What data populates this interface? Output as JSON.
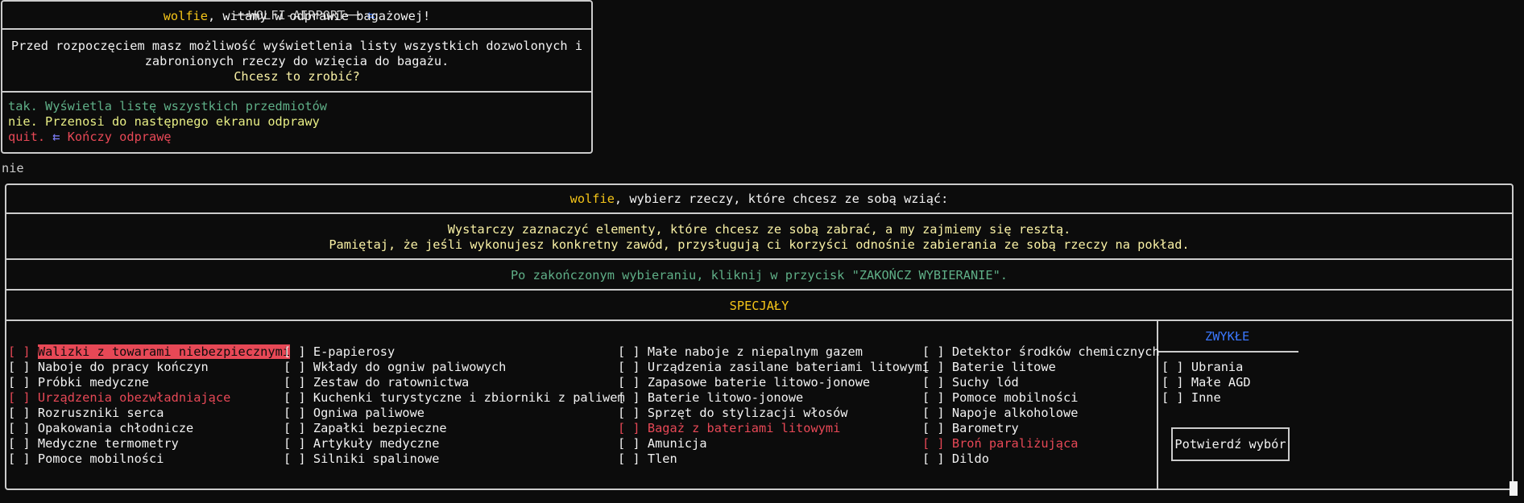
{
  "welcome_box": {
    "title": "WOLFI-AIRPORT",
    "greeting_user": "wolfie",
    "greeting_rest": ", witamy w odprawie bagażowej!",
    "info_line1": "Przed rozpoczęciem masz możliwość wyświetlenia listy wszystkich dozwolonych i",
    "info_line2": "zabronionych rzeczy do wzięcia do bagażu.",
    "question": "Chcesz to zrobić?",
    "options": [
      {
        "key": "tak.",
        "desc": " Wyświetla listę wszystkich przedmiotów"
      },
      {
        "key": "nie.",
        "desc": " Przenosi do następnego ekranu odprawy"
      },
      {
        "key": "quit.",
        "desc": " Kończy odprawę"
      }
    ]
  },
  "user_input": "nie",
  "selection": {
    "header_user": "wolfie",
    "header_rest": ", wybierz rzeczy, które chcesz ze sobą wziąć:",
    "instr_line1": "Wystarczy zaznaczyć elementy, które chcesz ze sobą zabrać, a my zajmiemy się resztą.",
    "instr_line2": "Pamiętaj, że jeśli wykonujesz konkretny zawód, przysługują ci korzyści odnośnie zabierania ze sobą rzeczy na pokład.",
    "finish_hint": "Po zakończonym wybieraniu, kliknij w przycisk \"ZAKOŃCZ WYBIERANIE\".",
    "specials_title": "SPECJAŁY",
    "checkbox_mark": "[ ]",
    "columns": [
      [
        {
          "label": "Walizki z towarami niebezpiecznymi",
          "state": "focused"
        },
        {
          "label": "Naboje do pracy kończyn",
          "state": "normal"
        },
        {
          "label": "Próbki medyczne",
          "state": "normal"
        },
        {
          "label": "Urządzenia obezwładniające",
          "state": "forbidden"
        },
        {
          "label": "Rozruszniki serca",
          "state": "normal"
        },
        {
          "label": "Opakowania chłodnicze",
          "state": "normal"
        },
        {
          "label": "Medyczne termometry",
          "state": "normal"
        },
        {
          "label": "Pomoce mobilności",
          "state": "normal"
        }
      ],
      [
        {
          "label": "E-papierosy",
          "state": "normal"
        },
        {
          "label": "Wkłady do ogniw paliwowych",
          "state": "normal"
        },
        {
          "label": "Zestaw do ratownictwa",
          "state": "normal"
        },
        {
          "label": "Kuchenki turystyczne i zbiorniki z paliwem",
          "state": "normal"
        },
        {
          "label": "Ogniwa paliwowe",
          "state": "normal"
        },
        {
          "label": "Zapałki bezpieczne",
          "state": "normal"
        },
        {
          "label": "Artykuły medyczne",
          "state": "normal"
        },
        {
          "label": "Silniki spalinowe",
          "state": "normal"
        }
      ],
      [
        {
          "label": "Małe naboje z niepalnym gazem",
          "state": "normal"
        },
        {
          "label": "Urządzenia zasilane bateriami litowymi",
          "state": "normal"
        },
        {
          "label": "Zapasowe baterie litowo-jonowe",
          "state": "normal"
        },
        {
          "label": "Baterie litowo-jonowe",
          "state": "normal"
        },
        {
          "label": "Sprzęt do stylizacji włosów",
          "state": "normal"
        },
        {
          "label": "Bagaż z bateriami litowymi",
          "state": "forbidden"
        },
        {
          "label": "Amunicja",
          "state": "normal"
        },
        {
          "label": "Tlen",
          "state": "normal"
        }
      ],
      [
        {
          "label": "Detektor środków chemicznych",
          "state": "normal"
        },
        {
          "label": "Baterie litowe",
          "state": "normal"
        },
        {
          "label": "Suchy lód",
          "state": "normal"
        },
        {
          "label": "Pomoce mobilności",
          "state": "normal"
        },
        {
          "label": "Napoje alkoholowe",
          "state": "normal"
        },
        {
          "label": "Barometry",
          "state": "normal"
        },
        {
          "label": "Broń paraliżująca",
          "state": "forbidden"
        },
        {
          "label": "Dildo",
          "state": "normal"
        }
      ]
    ],
    "regular_title": "ZWYKŁE",
    "regular_items": [
      {
        "label": "Ubrania",
        "state": "normal"
      },
      {
        "label": "Małe AGD",
        "state": "normal"
      },
      {
        "label": "Inne",
        "state": "normal"
      }
    ],
    "confirm_button": "Potwierdź wybór"
  },
  "colors": {
    "background": "#0c0c0c",
    "border": "#cccccc",
    "username": "#f5c518",
    "forbidden": "#e74856",
    "highlight": "#e74856",
    "heading_blue": "#3b78ff",
    "option_tak": "#5faf87",
    "option_nie": "#e8ee85",
    "option_quit": "#e74856"
  },
  "icons": {
    "arrow": "back-arrow-icon"
  }
}
